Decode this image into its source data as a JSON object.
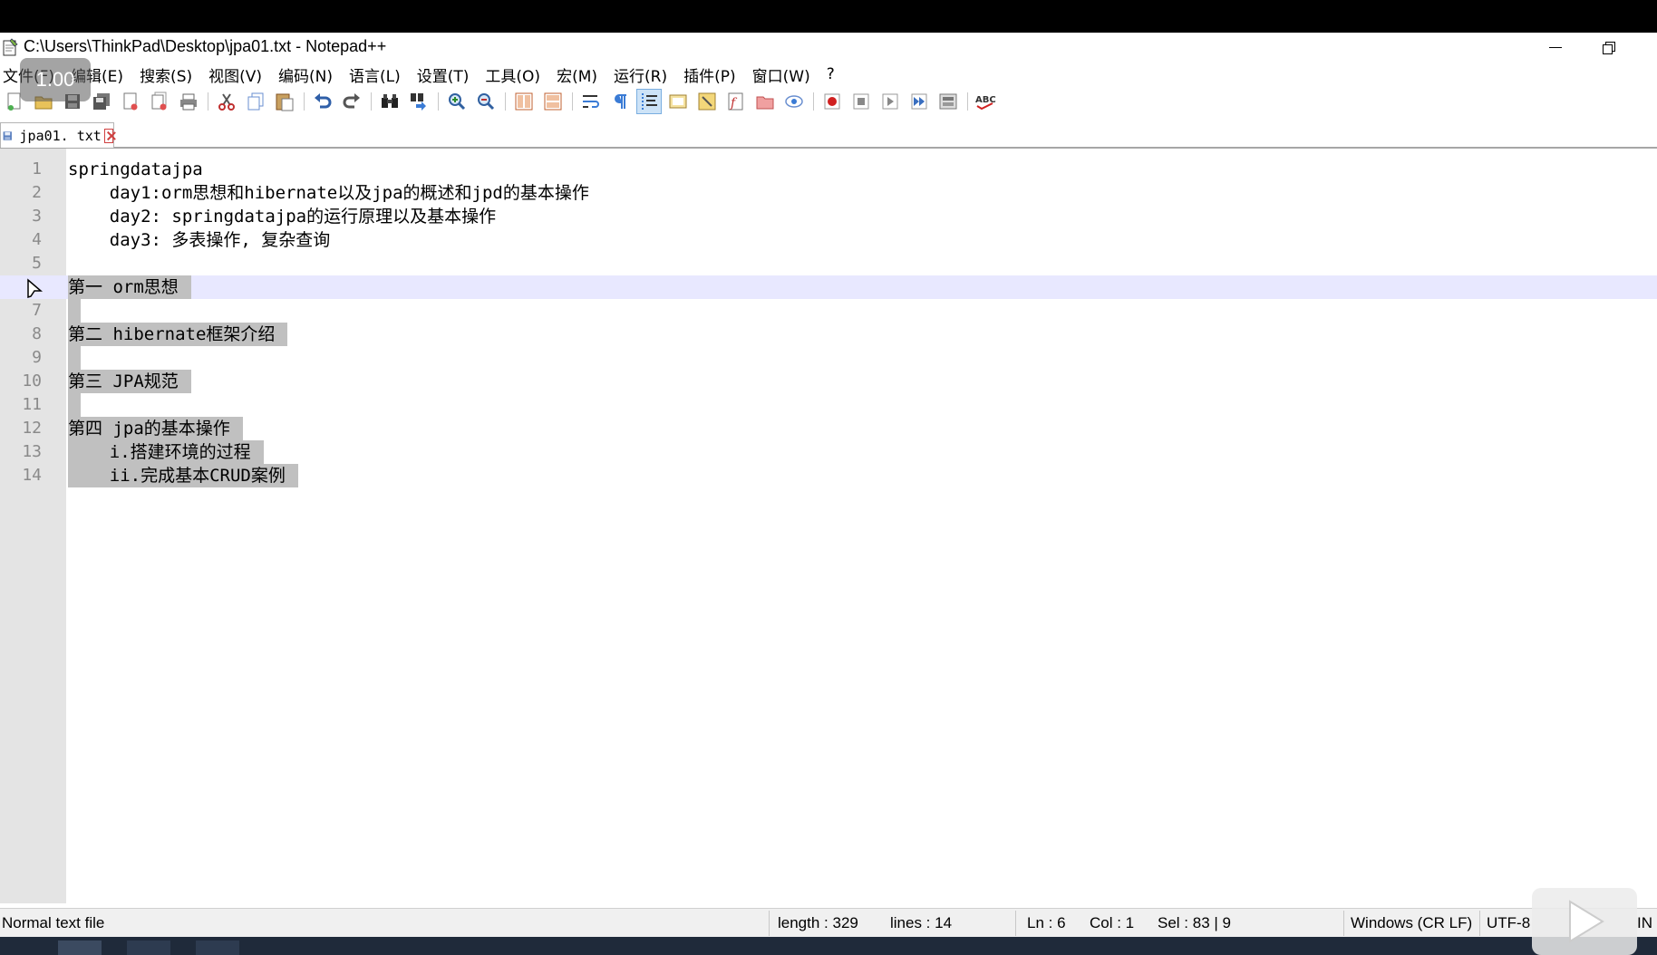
{
  "window": {
    "title": "C:\\Users\\ThinkPad\\Desktop\\jpa01.txt - Notepad++"
  },
  "menu": [
    "文件(F)",
    "编辑(E)",
    "搜索(S)",
    "视图(V)",
    "编码(N)",
    "语言(L)",
    "设置(T)",
    "工具(O)",
    "宏(M)",
    "运行(R)",
    "插件(P)",
    "窗口(W)",
    "?"
  ],
  "toolbar": {
    "icons": [
      "new-file-icon",
      "open-file-icon",
      "save-icon",
      "save-all-icon",
      "close-icon",
      "close-all-icon",
      "print-icon",
      "cut-icon",
      "copy-icon",
      "paste-icon",
      "undo-icon",
      "redo-icon",
      "find-icon",
      "replace-icon",
      "zoom-in-icon",
      "zoom-out-icon",
      "sync-vertical-icon",
      "sync-horizontal-icon",
      "word-wrap-icon",
      "show-all-chars-icon",
      "indent-guide-icon",
      "user-lang-icon",
      "doc-map-icon",
      "function-list-icon",
      "folder-workspace-icon",
      "monitoring-icon",
      "record-macro-icon",
      "stop-macro-icon",
      "play-macro-icon",
      "run-macro-multiple-icon",
      "save-macro-icon",
      "spell-check-icon"
    ],
    "spell_label": "ABC"
  },
  "tab": {
    "label": "jpa01. txt"
  },
  "editor": {
    "lines": [
      {
        "num": "1",
        "text": "springdatajpa"
      },
      {
        "num": "2",
        "text": "    day1:orm思想和hibernate以及jpa的概述和jpd的基本操作"
      },
      {
        "num": "3",
        "text": "    day2: springdatajpa的运行原理以及基本操作"
      },
      {
        "num": "4",
        "text": "    day3: 多表操作, 复杂查询"
      },
      {
        "num": "5",
        "text": ""
      },
      {
        "num": "6",
        "text": "第一 orm思想"
      },
      {
        "num": "7",
        "text": ""
      },
      {
        "num": "8",
        "text": "第二 hibernate框架介绍"
      },
      {
        "num": "9",
        "text": ""
      },
      {
        "num": "10",
        "text": "第三 JPA规范"
      },
      {
        "num": "11",
        "text": ""
      },
      {
        "num": "12",
        "text": "第四 jpa的基本操作"
      },
      {
        "num": "13",
        "text": "    i.搭建环境的过程"
      },
      {
        "num": "14",
        "text": "    ii.完成基本CRUD案例"
      }
    ],
    "current_line": 6,
    "selection_lines": [
      6,
      7,
      8,
      9,
      10,
      11,
      12,
      13,
      14
    ]
  },
  "status": {
    "file_type": "Normal text file",
    "length": "length : 329",
    "lines": "lines : 14",
    "ln": "Ln : 6",
    "col": "Col : 1",
    "sel": "Sel : 83 | 9",
    "eol": "Windows (CR LF)",
    "encoding": "UTF-8",
    "mode": "IN"
  },
  "overlay": {
    "speed": "1.00"
  }
}
